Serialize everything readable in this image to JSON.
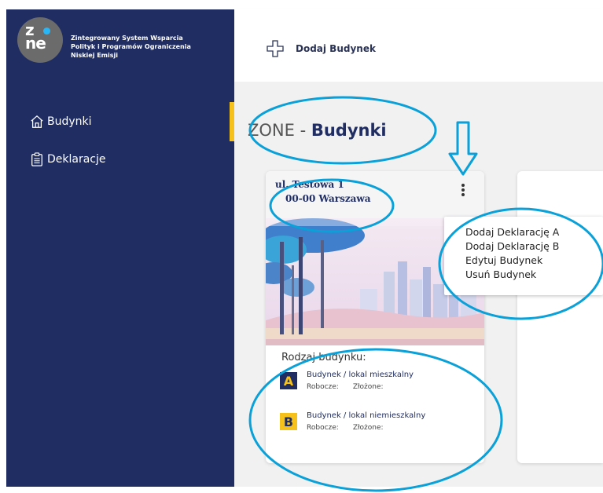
{
  "colors": {
    "sidebar": "#1f2d63",
    "accent": "#f7c11c",
    "main_bg": "#f1f1f2",
    "annotation": "#0aa0d8"
  },
  "sidebar": {
    "logo_text_top": "z",
    "logo_text_bottom": "ne",
    "app_title_line1": "Zintegrowany System Wsparcia",
    "app_title_line2": "Polityk i Programów Ograniczenia",
    "app_title_line3": "Niskiej Emisji",
    "items": [
      {
        "label": "Budynki",
        "icon": "house-icon",
        "active": true
      },
      {
        "label": "Deklaracje",
        "icon": "clipboard-icon",
        "active": false
      }
    ]
  },
  "topbar": {
    "add_label": "Dodaj Budynek",
    "add_icon": "plus-icon"
  },
  "page": {
    "title_prefix": "ZONE - ",
    "title_main": "Budynki"
  },
  "card": {
    "address_line1": "ul. Testowa 1",
    "address_line2": "00-00 Warszawa",
    "menu_icon": "kebab-menu-icon",
    "type_label": "Rodzaj budynku:",
    "types": [
      {
        "badge": "A",
        "name": "Budynek / lokal mieszkalny",
        "draft_label": "Robocze:",
        "submitted_label": "Złożone:"
      },
      {
        "badge": "B",
        "name": "Budynek / lokal niemieszkalny",
        "draft_label": "Robocze:",
        "submitted_label": "Złożone:"
      }
    ]
  },
  "menu": {
    "items": [
      "Dodaj Deklarację A",
      "Dodaj Deklarację B",
      "Edytuj Budynek",
      "Usuń Budynek"
    ]
  }
}
